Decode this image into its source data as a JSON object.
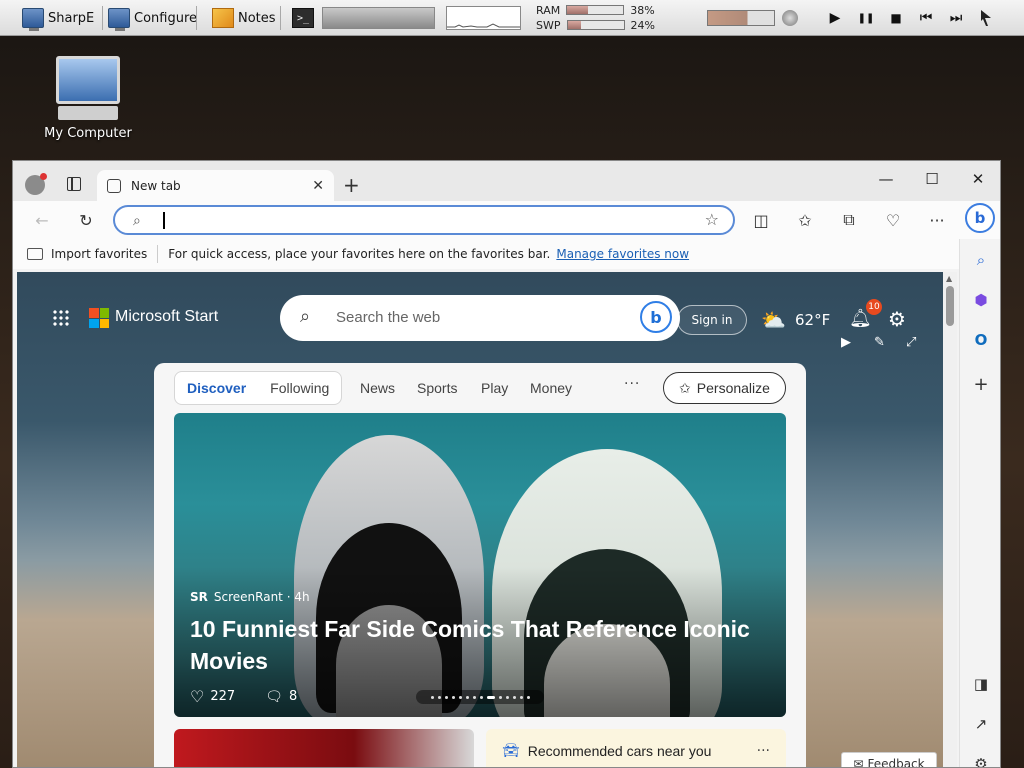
{
  "panel": {
    "tasks": [
      {
        "label": "SharpE",
        "icon": "monitor-icon"
      },
      {
        "label": "Configure",
        "icon": "monitor-icon"
      },
      {
        "label": "Notes",
        "icon": "notes-icon"
      }
    ],
    "terminal_icon": ">_",
    "ram_label": "RAM",
    "ram_percent": "38%",
    "ram_fraction": 0.38,
    "swap_label": "SWP",
    "swap_percent": "24%",
    "swap_fraction": 0.24,
    "media": {
      "play": "▶",
      "pause": "❚❚",
      "stop": "■",
      "prev": "⏮",
      "next": "⏭"
    }
  },
  "desktop": {
    "icon_label": "My Computer"
  },
  "browser": {
    "tab_title": "New tab",
    "tab_close": "✕",
    "new_tab": "+",
    "window_controls": {
      "minimize": "—",
      "maximize": "☐",
      "close": "✕"
    },
    "address_placeholder": "",
    "favorites_bar": {
      "import_label": "Import favorites",
      "message": "For quick access, place your favorites here on the favorites bar.",
      "link": "Manage favorites now"
    }
  },
  "page": {
    "brand": "Microsoft Start",
    "search_placeholder": "Search the web",
    "sign_in": "Sign in",
    "temperature": "62°F",
    "notification_count": "10",
    "segment_tabs": [
      {
        "label": "Discover",
        "active": true
      },
      {
        "label": "Following",
        "active": false
      }
    ],
    "nav_items": [
      "News",
      "Sports",
      "Play",
      "Money"
    ],
    "more": "···",
    "personalize": "Personalize",
    "hero": {
      "source": "ScreenRant · 4h",
      "source_logo": "SR",
      "headline": "10 Funniest Far Side Comics That Reference Iconic Movies",
      "likes": "227",
      "comments": "8"
    },
    "recommended": "Recommended cars near you",
    "recommended_more": "···",
    "feedback": "Feedback"
  },
  "colors": {
    "accent": "#1f5fbf",
    "bing_blue": "#2f7ee6",
    "badge": "#e84a1f"
  }
}
